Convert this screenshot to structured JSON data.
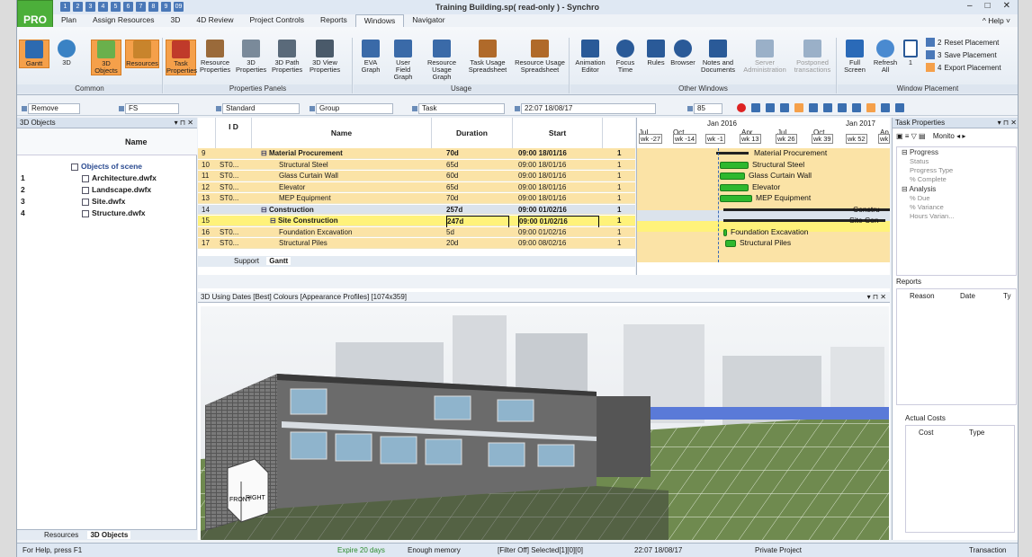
{
  "app": {
    "badge": "PRO",
    "title": "Training Building.sp( read-only ) - Synchro",
    "help_label": "Help",
    "quick_access": [
      "1",
      "2",
      "3",
      "4",
      "5",
      "6",
      "7",
      "8",
      "9",
      "09"
    ]
  },
  "ribbon_tabs": [
    "Plan",
    "Assign Resources",
    "3D",
    "4D Review",
    "Project Controls",
    "Reports",
    "Windows",
    "Navigator"
  ],
  "ribbon": {
    "common": {
      "label": "Common",
      "buttons": [
        "Gantt",
        "3D",
        "3D Objects",
        "Resources"
      ]
    },
    "properties_panels": {
      "label": "Properties Panels",
      "buttons": [
        "Task Properties",
        "Resource Properties",
        "3D Properties",
        "3D Path Properties",
        "3D View Properties"
      ]
    },
    "usage": {
      "label": "Usage",
      "buttons": [
        "EVA Graph",
        "User Field Graph",
        "Resource Usage Graph",
        "Task Usage Spreadsheet",
        "Resource Usage Spreadsheet"
      ]
    },
    "other_windows": {
      "label": "Other Windows",
      "buttons": [
        "Animation Editor",
        "Focus Time",
        "Rules",
        "Browser",
        "Notes and Documents",
        "Server Administration",
        "Postponed transactions"
      ]
    },
    "window_placement": {
      "label": "Window Placement",
      "buttons": [
        "Full Screen",
        "Refresh All",
        "1"
      ],
      "slots": [
        "2",
        "3",
        "4"
      ],
      "actions": [
        "Reset Placement",
        "Save Placement",
        "Export Placement"
      ]
    }
  },
  "toolbar": {
    "remove": "Remove",
    "fs": "FS",
    "standard": "Standard",
    "group": "Group",
    "task": "Task",
    "datetime": "22:07 18/08/17",
    "zoom": "85"
  },
  "objects_pane": {
    "title": "3D Objects",
    "column": "Name",
    "root": "Objects of scene",
    "rows": [
      {
        "n": "1",
        "name": "Architecture.dwfx"
      },
      {
        "n": "2",
        "name": "Landscape.dwfx"
      },
      {
        "n": "3",
        "name": "Site.dwfx"
      },
      {
        "n": "4",
        "name": "Structure.dwfx"
      }
    ],
    "bottom_tabs": [
      "Resources",
      "3D Objects"
    ]
  },
  "gantt": {
    "headers": {
      "id": "I D",
      "name": "Name",
      "duration": "Duration",
      "start": "Start"
    },
    "rows": [
      {
        "row": "9",
        "id": "",
        "name": "Material Procurement",
        "duration": "70d",
        "start": "09:00 18/01/16",
        "trail": "1"
      },
      {
        "row": "10",
        "id": "ST0...",
        "name": "Structural Steel",
        "duration": "65d",
        "start": "09:00 18/01/16",
        "trail": "1"
      },
      {
        "row": "11",
        "id": "ST0...",
        "name": "Glass Curtain Wall",
        "duration": "60d",
        "start": "09:00 18/01/16",
        "trail": "1"
      },
      {
        "row": "12",
        "id": "ST0...",
        "name": "Elevator",
        "duration": "65d",
        "start": "09:00 18/01/16",
        "trail": "1"
      },
      {
        "row": "13",
        "id": "ST0...",
        "name": "MEP Equipment",
        "duration": "70d",
        "start": "09:00 18/01/16",
        "trail": "1"
      },
      {
        "row": "14",
        "id": "",
        "name": "Construction",
        "duration": "257d",
        "start": "09:00 01/02/16",
        "trail": "1"
      },
      {
        "row": "15",
        "id": "",
        "name": "Site Construction",
        "duration": "247d",
        "start": "09:00 01/02/16",
        "trail": "1"
      },
      {
        "row": "16",
        "id": "ST0...",
        "name": "Foundation Excavation",
        "duration": "5d",
        "start": "09:00 01/02/16",
        "trail": "1"
      },
      {
        "row": "17",
        "id": "ST0...",
        "name": "Structural Piles",
        "duration": "20d",
        "start": "09:00 08/02/16",
        "trail": "1"
      }
    ],
    "bottom_tabs": [
      "Support",
      "Gantt"
    ],
    "timeline": {
      "years": [
        "Jan 2016",
        "Jan 2017"
      ],
      "months": [
        "Jul",
        "Oct",
        "Apr",
        "Jul",
        "Oct",
        "Ap"
      ],
      "weeks": [
        "wk -27",
        "wk -14",
        "wk -1",
        "wk 13",
        "wk 26",
        "wk 39",
        "wk 52",
        "wk"
      ]
    },
    "bar_labels": [
      "Material Procurement",
      "Structural Steel",
      "Glass Curtain Wall",
      "Elevator",
      "MEP Equipment",
      "Constru",
      "Site Con",
      "Foundation Excavation",
      "Structural Piles"
    ]
  },
  "view3d": {
    "title": "3D Using Dates [Best] Colours [Appearance Profiles] [1074x359]",
    "cube_front": "FRONT",
    "cube_right": "RIGHT"
  },
  "task_props": {
    "title": "Task Properties",
    "monitor_tab": "Monito",
    "sections": [
      {
        "name": "Progress",
        "items": [
          "Status",
          "Progress Type",
          "% Complete"
        ]
      },
      {
        "name": "Analysis",
        "items": [
          "% Due",
          "% Variance",
          "Hours Varian..."
        ]
      }
    ],
    "reports": {
      "title": "Reports",
      "cols": [
        "Reason",
        "Date",
        "Ty"
      ]
    },
    "actual_costs": {
      "title": "Actual Costs",
      "cols": [
        "Cost",
        "Type"
      ]
    }
  },
  "status": {
    "help": "For Help, press F1",
    "expire": "Expire 20 days",
    "memory": "Enough memory",
    "filter": "[Filter Off] Selected[1][0][0]",
    "time": "22:07 18/08/17",
    "project": "Private Project",
    "transaction": "Transaction"
  },
  "colors": {
    "accent": "#f5a04a",
    "pro_green": "#4caf3a",
    "gantt_bar": "#2eb82e",
    "row_highlight": "#fff27a",
    "row_orange": "#fbe3a6"
  }
}
